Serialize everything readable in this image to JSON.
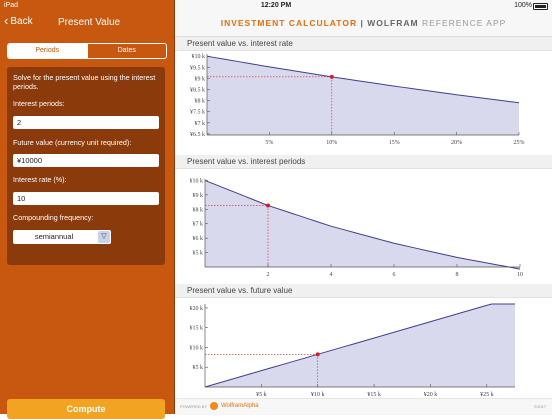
{
  "status_bar": {
    "carrier": "iPad",
    "time": "12:20 PM",
    "battery": "100%"
  },
  "nav": {
    "back_label": "Back",
    "title": "Present Value"
  },
  "tabs": [
    "Periods",
    "Dates"
  ],
  "panel": {
    "intro": "Solve for the present value using the interest periods.",
    "interest_periods_label": "Interest periods:",
    "interest_periods_value": "2",
    "future_value_label": "Future value (currency unit required):",
    "future_value_value": "¥10000",
    "interest_rate_label": "Interest rate (%):",
    "interest_rate_value": "10",
    "compounding_label": "Compounding frequency:",
    "compounding_value": "semiannual"
  },
  "compute_label": "Compute",
  "header": {
    "part1": "INVESTMENT CALCULATOR",
    "sep": " | ",
    "part2": "WOLFRAM",
    "part3": " REFERENCE APP"
  },
  "sections": [
    {
      "title": "Present value vs. interest rate"
    },
    {
      "title": "Present value vs. interest periods"
    },
    {
      "title": "Present value vs. future value"
    }
  ],
  "footer": {
    "powered_by": "POWERED BY",
    "brand": "WolframAlpha",
    "copyright": "©2017"
  },
  "colors": {
    "accent": "#c8570f",
    "curve": "#3f3f8f",
    "fill": "#d9d9ee",
    "marker": "#d0202a"
  },
  "chart_data": [
    {
      "type": "area",
      "title": "Present value vs. interest rate",
      "x_ticks": [
        5,
        10,
        15,
        20,
        25
      ],
      "x_tick_labels": [
        "5%",
        "10%",
        "15%",
        "20%",
        "25%"
      ],
      "y_ticks": [
        6500,
        7000,
        7500,
        8000,
        8500,
        9000,
        9500,
        10000
      ],
      "y_tick_labels": [
        "¥6.5 k",
        "¥7 k",
        "¥7.5 k",
        "¥8 k",
        "¥8.5 k",
        "¥9 k",
        "¥9.5 k",
        "¥10 k"
      ],
      "xlim": [
        0,
        25
      ],
      "ylim": [
        6450,
        10100
      ],
      "series": [
        {
          "x": [
            0,
            5,
            10,
            15,
            20,
            25
          ],
          "y": [
            10000,
            9518,
            9070,
            8653,
            8264,
            7901
          ]
        }
      ],
      "marker": {
        "x": 10,
        "y": 9070
      }
    },
    {
      "type": "area",
      "title": "Present value vs. interest periods",
      "x_ticks": [
        2,
        4,
        6,
        8,
        10
      ],
      "x_tick_labels": [
        "2",
        "4",
        "6",
        "8",
        "10"
      ],
      "y_ticks": [
        5000,
        6000,
        7000,
        8000,
        9000,
        10000
      ],
      "y_tick_labels": [
        "¥5 k",
        "¥6 k",
        "¥7 k",
        "¥8 k",
        "¥9 k",
        "¥10 k"
      ],
      "xlim": [
        0,
        10
      ],
      "ylim": [
        4000,
        10100
      ],
      "series": [
        {
          "x": [
            0,
            2,
            4,
            6,
            8,
            10
          ],
          "y": [
            10000,
            8264,
            6830,
            5645,
            4665,
            3855
          ]
        }
      ],
      "marker": {
        "x": 2,
        "y": 8264
      }
    },
    {
      "type": "area",
      "title": "Present value vs. future value",
      "x_ticks": [
        5000,
        10000,
        15000,
        20000,
        25000
      ],
      "x_tick_labels": [
        "¥5 k",
        "¥10 k",
        "¥15 k",
        "¥20 k",
        "¥25 k"
      ],
      "y_ticks": [
        5000,
        10000,
        15000,
        20000
      ],
      "y_tick_labels": [
        "¥5 k",
        "¥10 k",
        "¥15 k",
        "¥20 k"
      ],
      "xlim": [
        0,
        27500
      ],
      "ylim": [
        0,
        21000
      ],
      "series": [
        {
          "x": [
            0,
            27500
          ],
          "y": [
            0,
            22727
          ]
        }
      ],
      "marker": {
        "x": 10000,
        "y": 8264
      }
    }
  ]
}
